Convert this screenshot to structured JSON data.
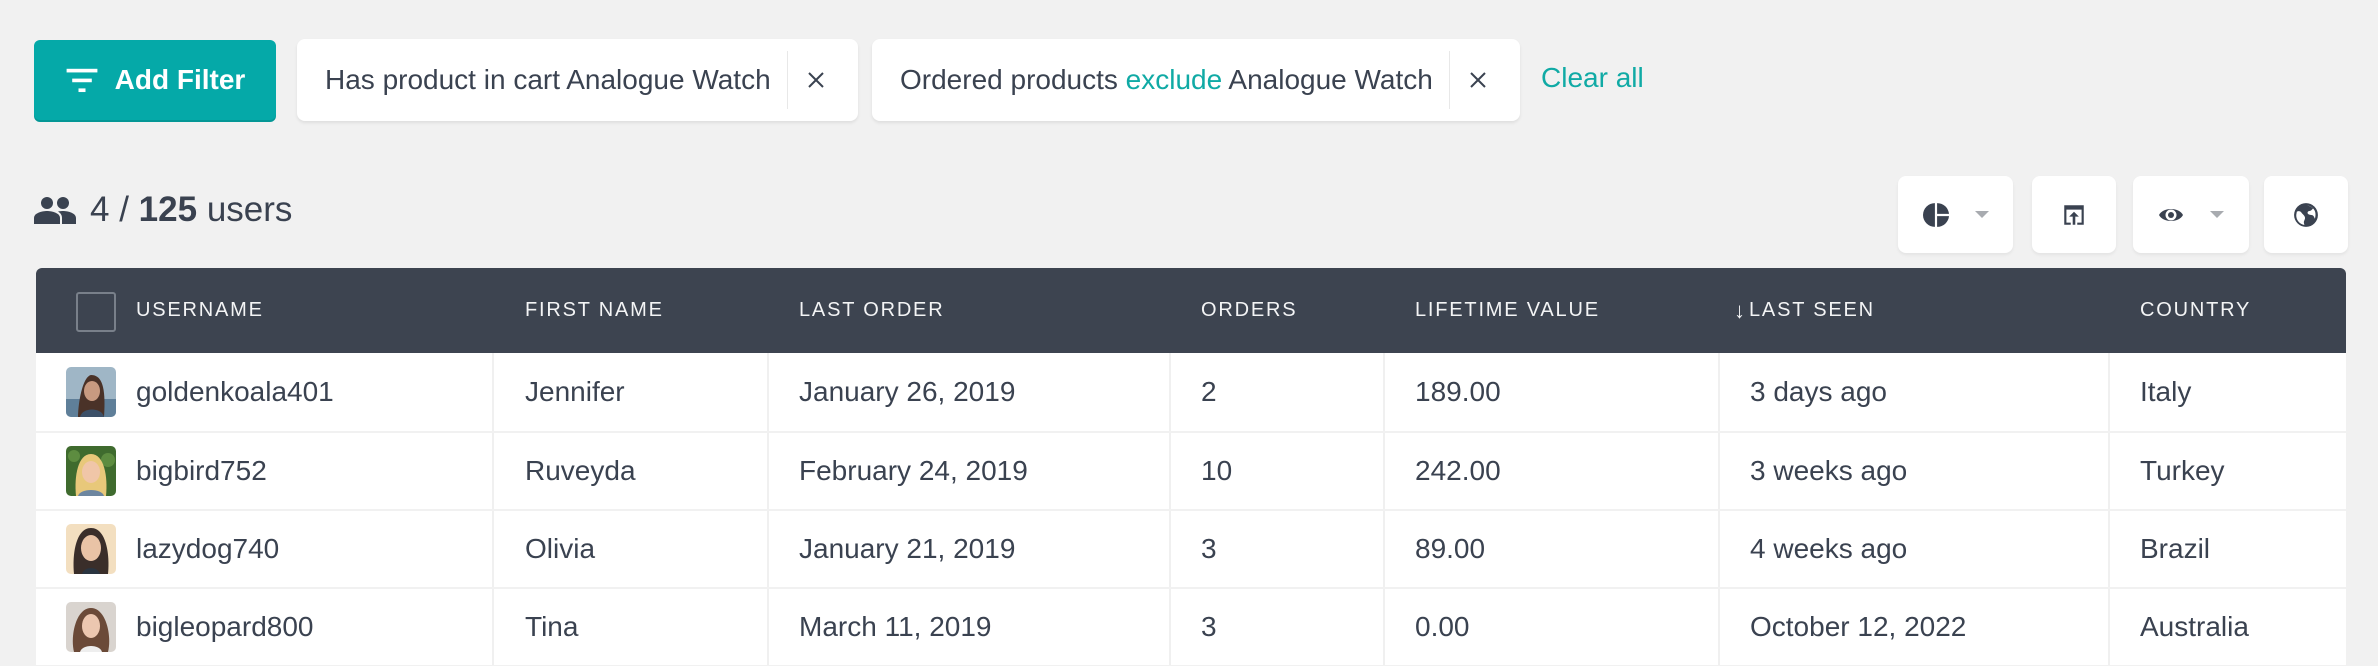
{
  "filter_bar": {
    "add_filter_label": "Add Filter",
    "filters": [
      {
        "prefix": "Has product in cart Analogue Watch",
        "operator": "",
        "suffix": ""
      },
      {
        "prefix": "Ordered products ",
        "operator": "exclude",
        "suffix": " Analogue Watch"
      }
    ],
    "clear_all_label": "Clear all"
  },
  "summary": {
    "shown": "4",
    "separator": "/",
    "total": "125",
    "unit": "users"
  },
  "toolbar": {
    "buttons": [
      {
        "icon": "pie-chart-icon",
        "has_dropdown": true
      },
      {
        "icon": "export-icon",
        "has_dropdown": false
      },
      {
        "icon": "eye-icon",
        "has_dropdown": true
      },
      {
        "icon": "globe-icon",
        "has_dropdown": false
      }
    ]
  },
  "table": {
    "columns": [
      "Username",
      "First Name",
      "Last Order",
      "Orders",
      "Lifetime Value",
      "Last Seen",
      "Country"
    ],
    "sorted_column": "Last Seen",
    "sort_direction_glyph": "↓",
    "rows": [
      {
        "username": "goldenkoala401",
        "first_name": "Jennifer",
        "last_order": "January 26, 2019",
        "orders": "2",
        "lifetime_value": "189.00",
        "last_seen": "3 days ago",
        "country": "Italy"
      },
      {
        "username": "bigbird752",
        "first_name": "Ruveyda",
        "last_order": "February 24, 2019",
        "orders": "10",
        "lifetime_value": "242.00",
        "last_seen": "3 weeks ago",
        "country": "Turkey"
      },
      {
        "username": "lazydog740",
        "first_name": "Olivia",
        "last_order": "January 21, 2019",
        "orders": "3",
        "lifetime_value": "89.00",
        "last_seen": "4 weeks ago",
        "country": "Brazil"
      },
      {
        "username": "bigleopard800",
        "first_name": "Tina",
        "last_order": "March 11, 2019",
        "orders": "3",
        "lifetime_value": "0.00",
        "last_seen": "October 12, 2022",
        "country": "Australia"
      }
    ]
  },
  "colors": {
    "accent": "#05a9a8",
    "link": "#10aaa5",
    "header_bg": "#3d4450",
    "text": "#3a4250",
    "page_bg": "#f1f1f1"
  }
}
